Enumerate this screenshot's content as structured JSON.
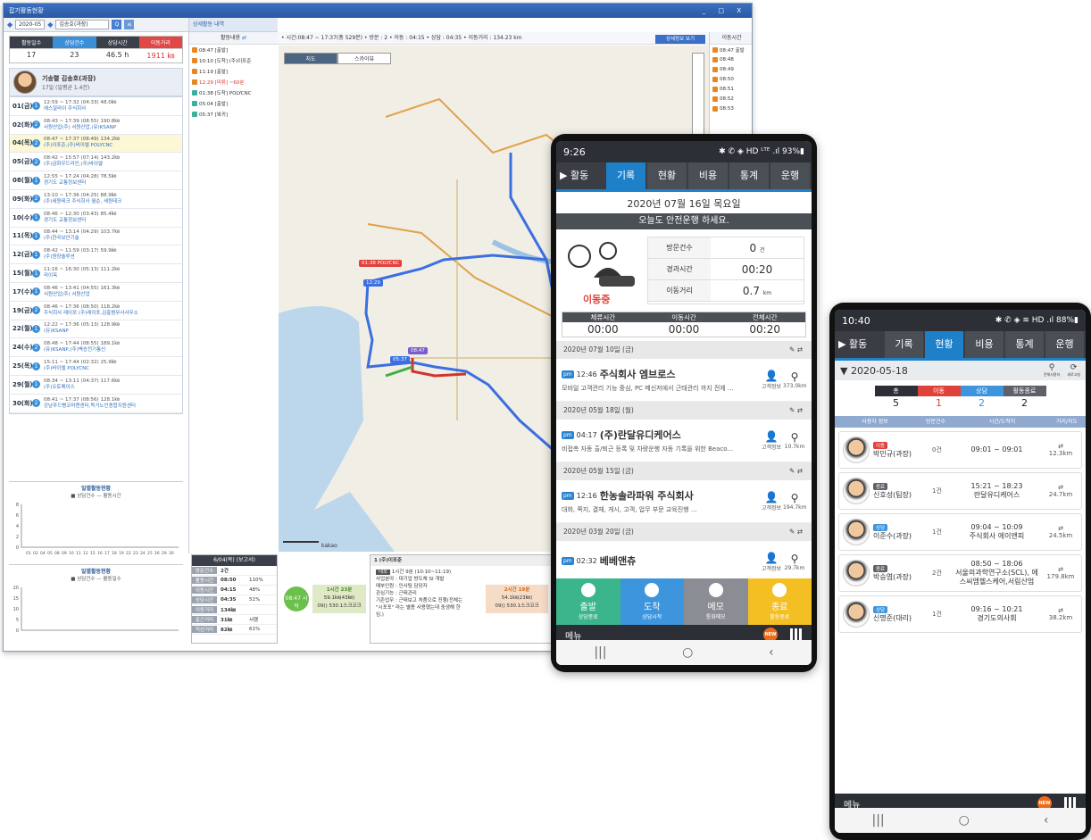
{
  "desktop": {
    "title": "잡기활동현황",
    "window_controls": "_ □ X",
    "toolbar": {
      "month": "2020-05",
      "person": "김송호(과장)"
    },
    "stats": {
      "headers": [
        "활동일수",
        "상담건수",
        "상담시간",
        "이동거리"
      ],
      "values": [
        "17",
        "23",
        "46.5 h",
        "1911 ㎞"
      ]
    },
    "profile": {
      "name": "기송렬 김송호(과장)",
      "sub": "17일 (일평균 1.4건)"
    },
    "days": [
      {
        "d": "01(금)",
        "n": "1",
        "t1": "12:59 ~ 17:32 (04:33)    48.0㎞",
        "t2": "에스알라이 주식회사"
      },
      {
        "d": "02(화)",
        "n": "2",
        "t1": "08:43 ~ 17:39 (08:55)    190.8㎞",
        "t2": "서원산업(주) 서원산업,(유)KSANP"
      },
      {
        "d": "04(목)",
        "n": "2",
        "t1": "08:47 ~ 17:37 (08:49)    134.2㎞",
        "t2": "(주)이포준,(주)바이엘 POLYCNC"
      },
      {
        "d": "05(금)",
        "n": "2",
        "t1": "08:42 ~ 15:57 (07:14)    143.2㎞",
        "t2": "(주)금화우드라인,(주)바이엘"
      },
      {
        "d": "08(월)",
        "n": "1",
        "t1": "12:55 ~ 17:24 (04:28)    78.5㎞",
        "t2": "경기도 교통정보센터"
      },
      {
        "d": "09(화)",
        "n": "2",
        "t1": "13:10 ~ 17:36 (04:25)    88.9㎞",
        "t2": "(주)세원테크 주식회사 월순, 세원테크"
      },
      {
        "d": "10(수)",
        "n": "1",
        "t1": "08:46 ~ 12:30 (03:43)    85.4㎞",
        "t2": "경기도 교통정보센터"
      },
      {
        "d": "11(목)",
        "n": "1",
        "t1": "08:44 ~ 13:14 (04:29)    103.7㎞",
        "t2": "(주)한국보안기술"
      },
      {
        "d": "12(금)",
        "n": "1",
        "t1": "08:42 ~ 11:59 (03:17)    59.9㎞",
        "t2": "(주)원양솔루션"
      },
      {
        "d": "15(월)",
        "n": "1",
        "t1": "11:16 ~ 16:30 (05:13)    111.2㎞",
        "t2": "라이옥"
      },
      {
        "d": "17(수)",
        "n": "1",
        "t1": "08:46 ~ 13:41 (04:55)    161.3㎞",
        "t2": "서원산업(주) 서원산업"
      },
      {
        "d": "19(금)",
        "n": "2",
        "t1": "08:46 ~ 17:36 (08:50)    118.2㎞",
        "t2": "주식회사 레이포 (주)레이포,김홍범무사사무소"
      },
      {
        "d": "22(월)",
        "n": "1",
        "t1": "12:22 ~ 17:36 (05:13)    128.9㎞",
        "t2": "(유)KSANP"
      },
      {
        "d": "24(수)",
        "n": "2",
        "t1": "08:48 ~ 17:44 (08:55)    189.1㎞",
        "t2": "(유)KSANP,(주)벽승전기통신"
      },
      {
        "d": "25(목)",
        "n": "1",
        "t1": "15:11 ~ 17:44 (02:32)    25.9㎞",
        "t2": "(주)바이엘 POLYCNC"
      },
      {
        "d": "29(월)",
        "n": "1",
        "t1": "08:34 ~ 13:11 (04:37)    117.6㎞",
        "t2": "(주)오토메이스"
      },
      {
        "d": "30(화)",
        "n": "2",
        "t1": "08:41 ~ 17:37 (08:56)    128.1㎞",
        "t2": "강남푸드빵코마켄센터,독거노인종합지원센터"
      }
    ],
    "activity": {
      "tab": "상세활동 내역",
      "header": "활동내용",
      "items": [
        {
          "t": "08:47 [출발]",
          "c": "#e8861f",
          "red": false
        },
        {
          "t": "10:10 [도착] (주)이포준",
          "c": "#e8861f",
          "red": false
        },
        {
          "t": "11:19 [출발]",
          "c": "#e8861f",
          "red": false
        },
        {
          "t": "12:29 [미류] ~60분",
          "c": "#e8861f",
          "red": true
        },
        {
          "t": "01:38 [도착] POLYCNC",
          "c": "#3ab0a0",
          "red": false
        },
        {
          "t": "05:04 [출발]",
          "c": "#3ab0a0",
          "red": false
        },
        {
          "t": "05:37 [복귀]",
          "c": "#3ab0a0",
          "red": false
        }
      ]
    },
    "infobar": "• 시간:08:47 ~ 17:37(총 529분) • 방문 : 2 • 이동 : 04:15 • 상담 : 04:35 • 이동거리 : 134.23 km",
    "detail_button": "상세정보 보기",
    "map": {
      "tab_map": "지도",
      "tab_sky": "스카이뷰",
      "pins": [
        "01:38 POLYCNC",
        "12:29",
        "08:47",
        "05:37"
      ],
      "scale": "kakao"
    },
    "movetime": {
      "header": "이동시간",
      "items": [
        "08:47 출발",
        "08:48",
        "08:49",
        "08:50",
        "08:51",
        "08:52",
        "08:53"
      ]
    },
    "chart1": {
      "title": "일별활동현황",
      "legend": "■ 상담건수  — 활동시간",
      "yticks": [
        "8",
        "6",
        "4",
        "2",
        "0"
      ],
      "xticks": [
        "01",
        "02",
        "04",
        "05",
        "08",
        "09",
        "10",
        "11",
        "12",
        "15",
        "16",
        "17",
        "18",
        "19",
        "22",
        "23",
        "24",
        "25",
        "26",
        "29",
        "30"
      ]
    },
    "chart2": {
      "title": "일별활동현황",
      "legend": "■ 상담건수  — 활동일수",
      "yticks": [
        "20",
        "15",
        "10",
        "5",
        "0"
      ]
    },
    "daypanel": {
      "title": "6/04(목) (보고서)",
      "rows": [
        {
          "k": "방문건수",
          "v": "2건",
          "p": ""
        },
        {
          "k": "활동시간",
          "v": "08:50",
          "p": "110%"
        },
        {
          "k": "이동시간",
          "v": "04:15",
          "p": "48%"
        },
        {
          "k": "상담시간",
          "v": "04:35",
          "p": "51%"
        },
        {
          "k": "이동거리",
          "v": "134㎞",
          "p": ""
        },
        {
          "k": "출근거리",
          "v": "31㎞",
          "p": "서행"
        },
        {
          "k": "직선거리",
          "v": "82㎞",
          "p": "61%"
        }
      ]
    },
    "timeline": {
      "start": "08:47 시작",
      "seg1": "1시간 23분",
      "seg1b": "59.1㎞(43㎞)",
      "seg1c": "09() 530.1스크코크",
      "seg2": "2시간 19분",
      "seg2b": "54.1㎞(23㎞)",
      "seg2c": "09() 530.1스크코크"
    },
    "memo": {
      "head": "1  (주)이포준",
      "tag": "대포",
      "time": "1시간 9분 (10:10~11:19)",
      "lines": [
        "사업분야 : 대기업 방도체 SI 개발",
        "매부인원 : 인사팀 담당자",
        "관심기능 : 근태관리",
        "기존업무 : 근태보고 처품으로 진행(전체는",
        "\"시포포\" 라는 별용 사용했는데 중생해 한",
        "임.)"
      ]
    }
  },
  "phone1": {
    "status_time": "9:26",
    "status_right": "✱ ✆ ◈ HD ᴸᵀᴱ .ıl 93%▮",
    "menu": "▶ 활동",
    "tabs": [
      "기록",
      "현황",
      "비용",
      "통계",
      "운행"
    ],
    "active_tab": 0,
    "date": "2020년 07월 16일 목요일",
    "safe": "오늘도 안전운행 하세요.",
    "state": "이동중",
    "rows": [
      {
        "k": "방문건수",
        "v": "0",
        "u": "건"
      },
      {
        "k": "경과시간",
        "v": "00:20",
        "u": ""
      },
      {
        "k": "이동거리",
        "v": "0.7",
        "u": "km"
      }
    ],
    "time_heads": [
      "체류시간",
      "이동시간",
      "전체시간"
    ],
    "time_vals": [
      "00:00",
      "00:00",
      "00:20"
    ],
    "records": [
      {
        "date": "2020년 07월 10일 (금)",
        "time": "12:46",
        "co": "주식회사 엠브로스",
        "desc": "모바일 고객관리 기능 중심, PC 메신저에서 근태관리 까지 전체 ...",
        "i1": "고객정보",
        "i2": "373.0km"
      },
      {
        "date": "2020년 05월 18일 (월)",
        "time": "04:17",
        "co": "(주)란달유디케어스",
        "desc": "비접촉 자동 출/퇴근 등록 및 차량운행 자동 기록을 위한 Beaco...",
        "i1": "고객정보",
        "i2": "10.7km"
      },
      {
        "date": "2020년 05월 15일 (금)",
        "time": "12:16",
        "co": "한농솔라파워 주식회사",
        "desc": "대화, 쪽지, 결재, 게시, 고객, 업무 부문 교육진행 ...",
        "i1": "고객정보",
        "i2": "194.7km"
      },
      {
        "date": "2020년 03월 20일 (금)",
        "time": "02:32",
        "co": "베베앤츄",
        "desc": "",
        "i1": "고객정보",
        "i2": "29.7km"
      }
    ],
    "pm": "pm",
    "actions": [
      {
        "label": "출발",
        "sub": "상담종료",
        "c": "#3bb58c"
      },
      {
        "label": "도착",
        "sub": "상담시작",
        "c": "#3d95dd"
      },
      {
        "label": "메모",
        "sub": "통화메모",
        "c": "#8a8d93"
      },
      {
        "label": "종료",
        "sub": "활동종료",
        "c": "#f4bf22"
      }
    ],
    "menu_bottom": "메뉴",
    "new": "NEW"
  },
  "phone2": {
    "status_time": "10:40",
    "status_right": "✱ ✆ ◈ ≋ HD .ıl 88%▮",
    "menu": "▶ 활동",
    "tabs": [
      "기록",
      "현황",
      "비용",
      "통계",
      "운행"
    ],
    "active_tab": 1,
    "date": "▼ 2020-05-18",
    "icon_labels": [
      "전체사용자",
      "새로고침"
    ],
    "summary": [
      {
        "h": "총",
        "v": "5",
        "c": "#2c2f35",
        "vc": "#222"
      },
      {
        "h": "이동",
        "v": "1",
        "c": "#e0413a",
        "vc": "#e0413a"
      },
      {
        "h": "상담",
        "v": "2",
        "c": "#3d95dd",
        "vc": "#3d95dd"
      },
      {
        "h": "활동종료",
        "v": "2",
        "c": "#5e6168",
        "vc": "#222"
      }
    ],
    "cols": [
      "사용자 정보",
      "방문건수",
      "시간/도착지",
      "거리/지도"
    ],
    "people": [
      {
        "tag": "이동",
        "tc": "#e0413a",
        "name": "박민규(과장)",
        "cnt": "0건",
        "time": "09:01 ~ 09:01",
        "place": "",
        "dist": "12.3km"
      },
      {
        "tag": "종료",
        "tc": "#5e6168",
        "name": "신호성(팀장)",
        "cnt": "1건",
        "time": "15:21 ~ 18:23",
        "place": "란달유디케어스",
        "dist": "24.7km"
      },
      {
        "tag": "상담",
        "tc": "#3d95dd",
        "name": "이준수(과장)",
        "cnt": "1건",
        "time": "09:04 ~ 10:09",
        "place": "주식회사 에이앤피",
        "dist": "24.5km"
      },
      {
        "tag": "종료",
        "tc": "#5e6168",
        "name": "박승엽(과장)",
        "cnt": "2건",
        "time": "08:50 ~ 18:06",
        "place": "서울의과학연구소(SCL), 에스씨엠헬스케어,서림산업",
        "dist": "179.8km"
      },
      {
        "tag": "상담",
        "tc": "#3d95dd",
        "name": "신명준(대리)",
        "cnt": "1건",
        "time": "09:16 ~ 10:21",
        "place": "경기도의사회",
        "dist": "38.2km"
      }
    ],
    "menu_bottom": "메뉴",
    "new": "NEW"
  }
}
